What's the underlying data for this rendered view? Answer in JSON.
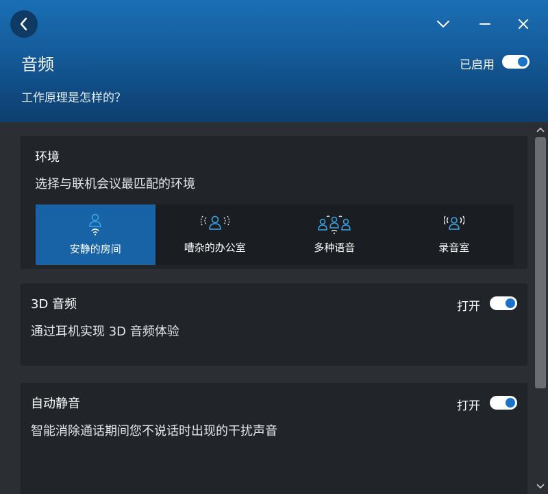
{
  "header": {
    "title": "音频",
    "enabled_label": "已启用",
    "enabled": true,
    "link_text": "工作原理是怎样的？"
  },
  "icons": {
    "back": "chevron-left-icon",
    "collapse": "chevron-down-icon",
    "minimize": "minimize-icon",
    "close": "close-icon"
  },
  "environment": {
    "title": "环境",
    "description": "选择与联机会议最匹配的环境",
    "selected": "quiet-room",
    "options": [
      {
        "label": "安静的房间",
        "icon": "person-icon"
      },
      {
        "label": "嘈杂的办公室",
        "icon": "noisy-office-icon"
      },
      {
        "label": "多种语音",
        "icon": "multiple-voices-icon"
      },
      {
        "label": "录音室",
        "icon": "studio-icon"
      }
    ]
  },
  "audio3d": {
    "title": "3D 音频",
    "description": "通过耳机实现 3D 音频体验",
    "switch_label": "打开",
    "on": true
  },
  "automute": {
    "title": "自动静音",
    "description": "智能消除通话期间您不说话时出现的干扰声音",
    "switch_label": "打开",
    "on": true
  },
  "colors": {
    "accent": "#1a73c9",
    "header_top": "#1a6fb5",
    "header_bottom": "#0d3e6f",
    "card_bg": "#212429",
    "page_bg": "#2b2e33",
    "selected_option": "#1863a6",
    "icon_blue": "#39a6e6"
  }
}
